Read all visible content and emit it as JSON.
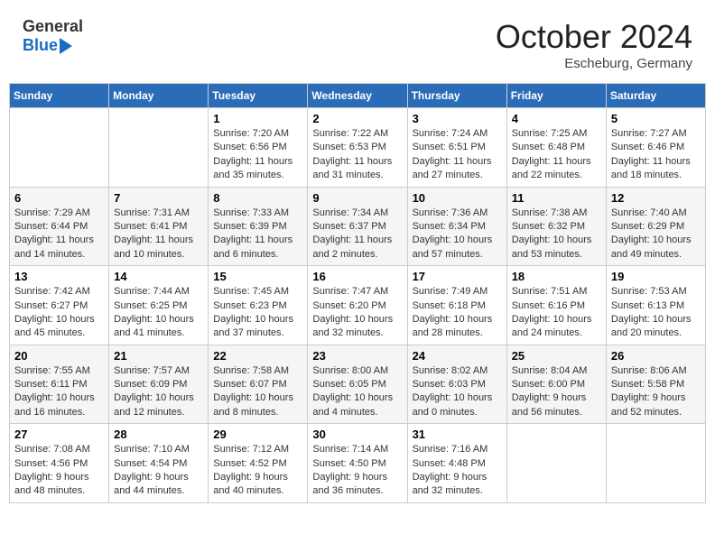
{
  "header": {
    "logo_line1": "General",
    "logo_line2": "Blue",
    "month": "October 2024",
    "location": "Escheburg, Germany"
  },
  "weekdays": [
    "Sunday",
    "Monday",
    "Tuesday",
    "Wednesday",
    "Thursday",
    "Friday",
    "Saturday"
  ],
  "weeks": [
    [
      {
        "day": "",
        "info": ""
      },
      {
        "day": "",
        "info": ""
      },
      {
        "day": "1",
        "info": "Sunrise: 7:20 AM\nSunset: 6:56 PM\nDaylight: 11 hours and 35 minutes."
      },
      {
        "day": "2",
        "info": "Sunrise: 7:22 AM\nSunset: 6:53 PM\nDaylight: 11 hours and 31 minutes."
      },
      {
        "day": "3",
        "info": "Sunrise: 7:24 AM\nSunset: 6:51 PM\nDaylight: 11 hours and 27 minutes."
      },
      {
        "day": "4",
        "info": "Sunrise: 7:25 AM\nSunset: 6:48 PM\nDaylight: 11 hours and 22 minutes."
      },
      {
        "day": "5",
        "info": "Sunrise: 7:27 AM\nSunset: 6:46 PM\nDaylight: 11 hours and 18 minutes."
      }
    ],
    [
      {
        "day": "6",
        "info": "Sunrise: 7:29 AM\nSunset: 6:44 PM\nDaylight: 11 hours and 14 minutes."
      },
      {
        "day": "7",
        "info": "Sunrise: 7:31 AM\nSunset: 6:41 PM\nDaylight: 11 hours and 10 minutes."
      },
      {
        "day": "8",
        "info": "Sunrise: 7:33 AM\nSunset: 6:39 PM\nDaylight: 11 hours and 6 minutes."
      },
      {
        "day": "9",
        "info": "Sunrise: 7:34 AM\nSunset: 6:37 PM\nDaylight: 11 hours and 2 minutes."
      },
      {
        "day": "10",
        "info": "Sunrise: 7:36 AM\nSunset: 6:34 PM\nDaylight: 10 hours and 57 minutes."
      },
      {
        "day": "11",
        "info": "Sunrise: 7:38 AM\nSunset: 6:32 PM\nDaylight: 10 hours and 53 minutes."
      },
      {
        "day": "12",
        "info": "Sunrise: 7:40 AM\nSunset: 6:29 PM\nDaylight: 10 hours and 49 minutes."
      }
    ],
    [
      {
        "day": "13",
        "info": "Sunrise: 7:42 AM\nSunset: 6:27 PM\nDaylight: 10 hours and 45 minutes."
      },
      {
        "day": "14",
        "info": "Sunrise: 7:44 AM\nSunset: 6:25 PM\nDaylight: 10 hours and 41 minutes."
      },
      {
        "day": "15",
        "info": "Sunrise: 7:45 AM\nSunset: 6:23 PM\nDaylight: 10 hours and 37 minutes."
      },
      {
        "day": "16",
        "info": "Sunrise: 7:47 AM\nSunset: 6:20 PM\nDaylight: 10 hours and 32 minutes."
      },
      {
        "day": "17",
        "info": "Sunrise: 7:49 AM\nSunset: 6:18 PM\nDaylight: 10 hours and 28 minutes."
      },
      {
        "day": "18",
        "info": "Sunrise: 7:51 AM\nSunset: 6:16 PM\nDaylight: 10 hours and 24 minutes."
      },
      {
        "day": "19",
        "info": "Sunrise: 7:53 AM\nSunset: 6:13 PM\nDaylight: 10 hours and 20 minutes."
      }
    ],
    [
      {
        "day": "20",
        "info": "Sunrise: 7:55 AM\nSunset: 6:11 PM\nDaylight: 10 hours and 16 minutes."
      },
      {
        "day": "21",
        "info": "Sunrise: 7:57 AM\nSunset: 6:09 PM\nDaylight: 10 hours and 12 minutes."
      },
      {
        "day": "22",
        "info": "Sunrise: 7:58 AM\nSunset: 6:07 PM\nDaylight: 10 hours and 8 minutes."
      },
      {
        "day": "23",
        "info": "Sunrise: 8:00 AM\nSunset: 6:05 PM\nDaylight: 10 hours and 4 minutes."
      },
      {
        "day": "24",
        "info": "Sunrise: 8:02 AM\nSunset: 6:03 PM\nDaylight: 10 hours and 0 minutes."
      },
      {
        "day": "25",
        "info": "Sunrise: 8:04 AM\nSunset: 6:00 PM\nDaylight: 9 hours and 56 minutes."
      },
      {
        "day": "26",
        "info": "Sunrise: 8:06 AM\nSunset: 5:58 PM\nDaylight: 9 hours and 52 minutes."
      }
    ],
    [
      {
        "day": "27",
        "info": "Sunrise: 7:08 AM\nSunset: 4:56 PM\nDaylight: 9 hours and 48 minutes."
      },
      {
        "day": "28",
        "info": "Sunrise: 7:10 AM\nSunset: 4:54 PM\nDaylight: 9 hours and 44 minutes."
      },
      {
        "day": "29",
        "info": "Sunrise: 7:12 AM\nSunset: 4:52 PM\nDaylight: 9 hours and 40 minutes."
      },
      {
        "day": "30",
        "info": "Sunrise: 7:14 AM\nSunset: 4:50 PM\nDaylight: 9 hours and 36 minutes."
      },
      {
        "day": "31",
        "info": "Sunrise: 7:16 AM\nSunset: 4:48 PM\nDaylight: 9 hours and 32 minutes."
      },
      {
        "day": "",
        "info": ""
      },
      {
        "day": "",
        "info": ""
      }
    ]
  ]
}
